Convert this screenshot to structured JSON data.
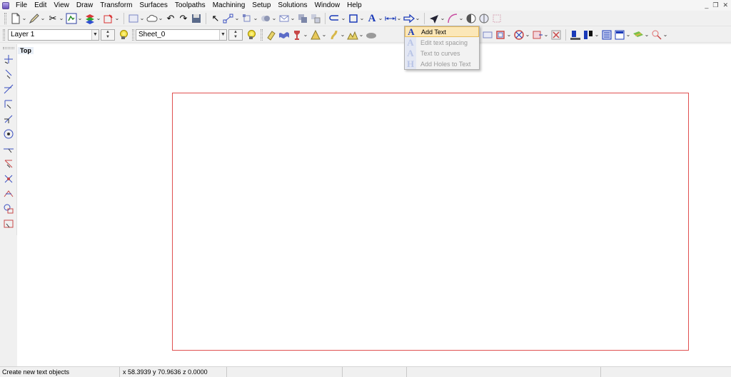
{
  "menubar": {
    "items": [
      "File",
      "Edit",
      "View",
      "Draw",
      "Transform",
      "Surfaces",
      "Toolpaths",
      "Machining",
      "Setup",
      "Solutions",
      "Window",
      "Help"
    ],
    "window_controls": [
      "_",
      "❐",
      "✕"
    ]
  },
  "layer_select": {
    "value": "Layer 1"
  },
  "sheet_select": {
    "value": "Sheet_0"
  },
  "viewport": {
    "label": "Top"
  },
  "colors": {
    "accent_blue": "#1a3ab8",
    "sheet_border": "#e05050",
    "highlight": "#fbe7b8"
  },
  "text_menu": {
    "items": [
      {
        "label": "Add Text",
        "icon": "text-A-icon",
        "enabled": true
      },
      {
        "label": "Edit text spacing",
        "icon": "text-spacing-icon",
        "enabled": false
      },
      {
        "label": "Text to curves",
        "icon": "text-curves-icon",
        "enabled": false
      },
      {
        "label": "Add Holes to Text",
        "icon": "text-holes-icon",
        "enabled": false
      }
    ]
  },
  "statusbar": {
    "message": "Create new text objects",
    "coords": "x 58.3939 y 70.9636 z 0.0000"
  }
}
